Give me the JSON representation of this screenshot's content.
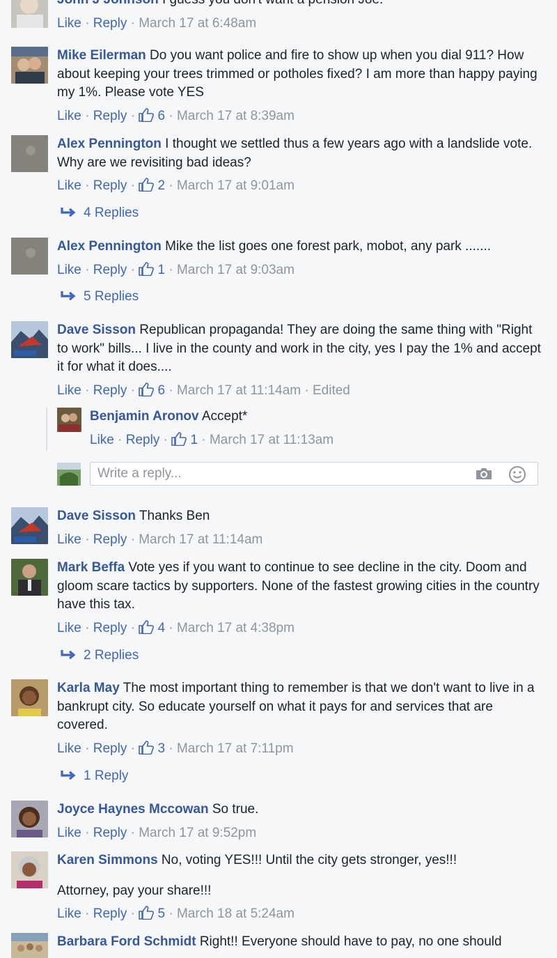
{
  "ui": {
    "like": "Like",
    "reply": "Reply",
    "sep": " · ",
    "write_reply_placeholder": "Write a reply..."
  },
  "comments": [
    {
      "author": "John J Johnson",
      "text": " I guess you don't want a pension Joe.",
      "time": "March 17 at 6:48am"
    },
    {
      "author": "Mike Eilerman",
      "text": " Do you want police and fire to show up when you dial 911? How about keeping your trees trimmed or potholes fixed? I am more than happy paying my 1%. Please vote YES",
      "likes": "6",
      "time": "March 17 at 8:39am"
    },
    {
      "author": "Alex Pennington",
      "text": " I thought we settled thus a few years ago with a landslide vote. Why are we revisiting bad ideas?",
      "likes": "2",
      "time": "March 17 at 9:01am",
      "replies": "4 Replies"
    },
    {
      "author": "Alex Pennington",
      "text": " Mike the list goes one forest park, mobot, any park .......",
      "likes": "1",
      "time": "March 17 at 9:03am",
      "replies": "5 Replies"
    },
    {
      "author": "Dave Sisson",
      "text": " Republican propaganda! They are doing the same thing with \"Right to work\" bills... I live in the county and work in the city, yes I pay the 1% and accept it for what it does....",
      "likes": "6",
      "time": "March 17 at 11:14am",
      "edited": "Edited",
      "nested": {
        "author": "Benjamin Aronov",
        "text": " Accept*",
        "likes": "1",
        "time": "March 17 at 11:13am"
      }
    },
    {
      "author": "Dave Sisson",
      "text": " Thanks Ben",
      "time": "March 17 at 11:14am"
    },
    {
      "author": "Mark Beffa",
      "text": " Vote yes if you want to continue to see decline in the city. Doom and gloom scare tactics by supporters. None of the fastest growing cities in the country have this tax.",
      "likes": "4",
      "time": "March 17 at 4:38pm",
      "replies": "2 Replies"
    },
    {
      "author": "Karla May",
      "text": " The most important thing to remember is that we don't want to live in a bankrupt city. So educate yourself on what it pays for and services that are covered.",
      "likes": "3",
      "time": "March 17 at 7:11pm",
      "replies": "1 Reply"
    },
    {
      "author": "Joyce Haynes Mccowan",
      "text": " So true.",
      "time": "March 17 at 9:52pm"
    },
    {
      "author": "Karen Simmons",
      "text": " No, voting YES!!! Until the city gets stronger, yes!!!",
      "text2": "Attorney, pay your share!!!",
      "likes": "5",
      "time": "March 18 at 5:24am"
    },
    {
      "author": "Barbara Ford Schmidt",
      "text": " Right!! Everyone should have to pay, no one should"
    }
  ],
  "colors": {
    "author": "#365899",
    "link": "#4267b2",
    "meta": "#90949c",
    "background": "#f6f7f9"
  }
}
